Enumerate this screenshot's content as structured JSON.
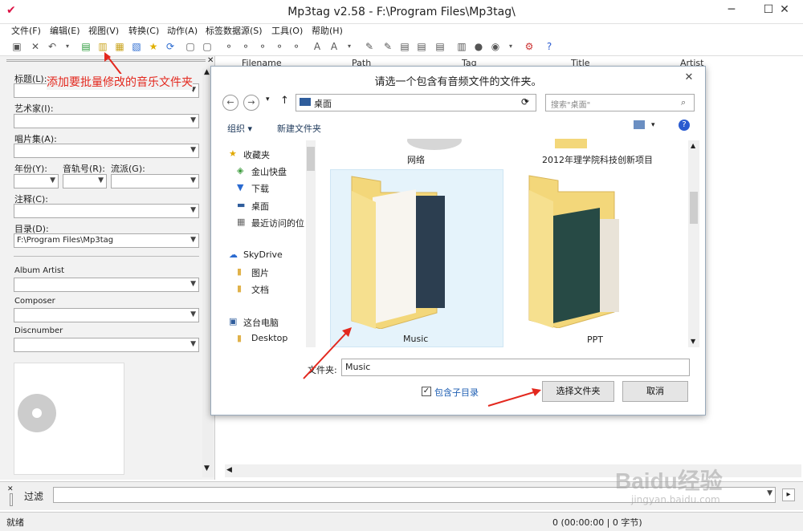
{
  "window": {
    "title": "Mp3tag v2.58 - F:\\Program Files\\Mp3tag\\"
  },
  "menu": [
    "文件(F)",
    "编辑(E)",
    "视图(V)",
    "转换(C)",
    "动作(A)",
    "标签数据源(S)",
    "工具(O)",
    "帮助(H)"
  ],
  "annotation": "添加要批量修改的音乐文件夹",
  "left_panel": {
    "title_label": "标题(L):",
    "artist_label": "艺术家(I):",
    "album_label": "唱片集(A):",
    "year_label": "年份(Y):",
    "track_label": "音轨号(R):",
    "genre_label": "流派(G):",
    "comment_label": "注释(C):",
    "directory_label": "目录(D):",
    "directory_value": "F:\\Program Files\\Mp3tag",
    "album_artist_label": "Album Artist",
    "composer_label": "Composer",
    "discnumber_label": "Discnumber"
  },
  "file_list": {
    "columns": [
      "Filename",
      "Path",
      "Tag",
      "Title",
      "Artist"
    ]
  },
  "dialog": {
    "title": "请选一个包含有音频文件的文件夹。",
    "address": "桌面",
    "search_placeholder": "搜索\"桌面\"",
    "organize": "组织 ▾",
    "new_folder": "新建文件夹",
    "nav_items": [
      "收藏夹",
      "金山快盘",
      "下载",
      "桌面",
      "最近访问的位",
      "SkyDrive",
      "图片",
      "文档",
      "这台电脑",
      "Desktop"
    ],
    "folders_top": [
      "网络",
      "2012年理学院科技创新项目"
    ],
    "folders": [
      "Music",
      "PPT"
    ],
    "folder_label": "文件夹:",
    "folder_value": "Music",
    "include_subdirs": "包含子目录",
    "select_button": "选择文件夹",
    "cancel_button": "取消"
  },
  "filter": {
    "label": "过滤"
  },
  "status": {
    "left": "就绪",
    "right": "0 (00:00:00 | 0 字节)"
  },
  "watermark": {
    "main": "Baidu经验",
    "sub": "jingyan.baidu.com"
  },
  "colors": {
    "annotation": "#e3281e",
    "folder": "#f3d77a",
    "link": "#1f5fb3"
  }
}
